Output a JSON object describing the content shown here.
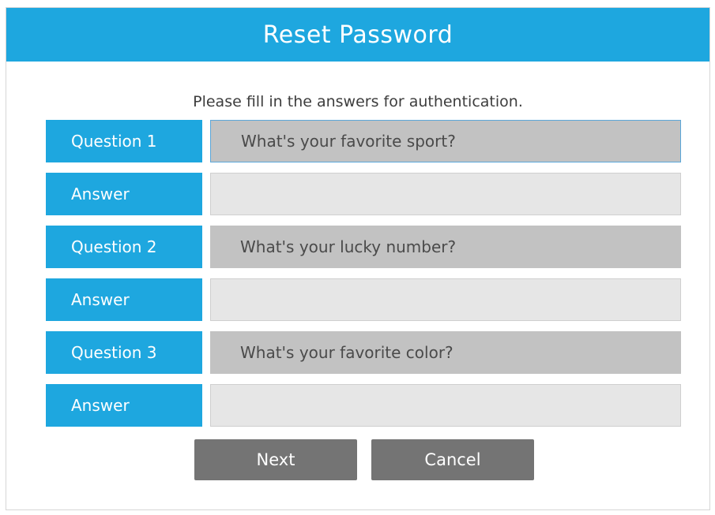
{
  "dialog": {
    "title": "Reset Password",
    "instruction": "Please fill in the answers for authentication."
  },
  "questions": [
    {
      "label": "Question 1",
      "text": "What's your favorite sport?",
      "answer_label": "Answer",
      "answer_value": ""
    },
    {
      "label": "Question 2",
      "text": "What's your lucky number?",
      "answer_label": "Answer",
      "answer_value": ""
    },
    {
      "label": "Question 3",
      "text": "What's your favorite color?",
      "answer_label": "Answer",
      "answer_value": ""
    }
  ],
  "buttons": {
    "next": "Next",
    "cancel": "Cancel"
  },
  "colors": {
    "accent": "#1ea7df",
    "button": "#747474",
    "question_field": "#c2c2c2",
    "answer_field": "#e6e6e6"
  }
}
